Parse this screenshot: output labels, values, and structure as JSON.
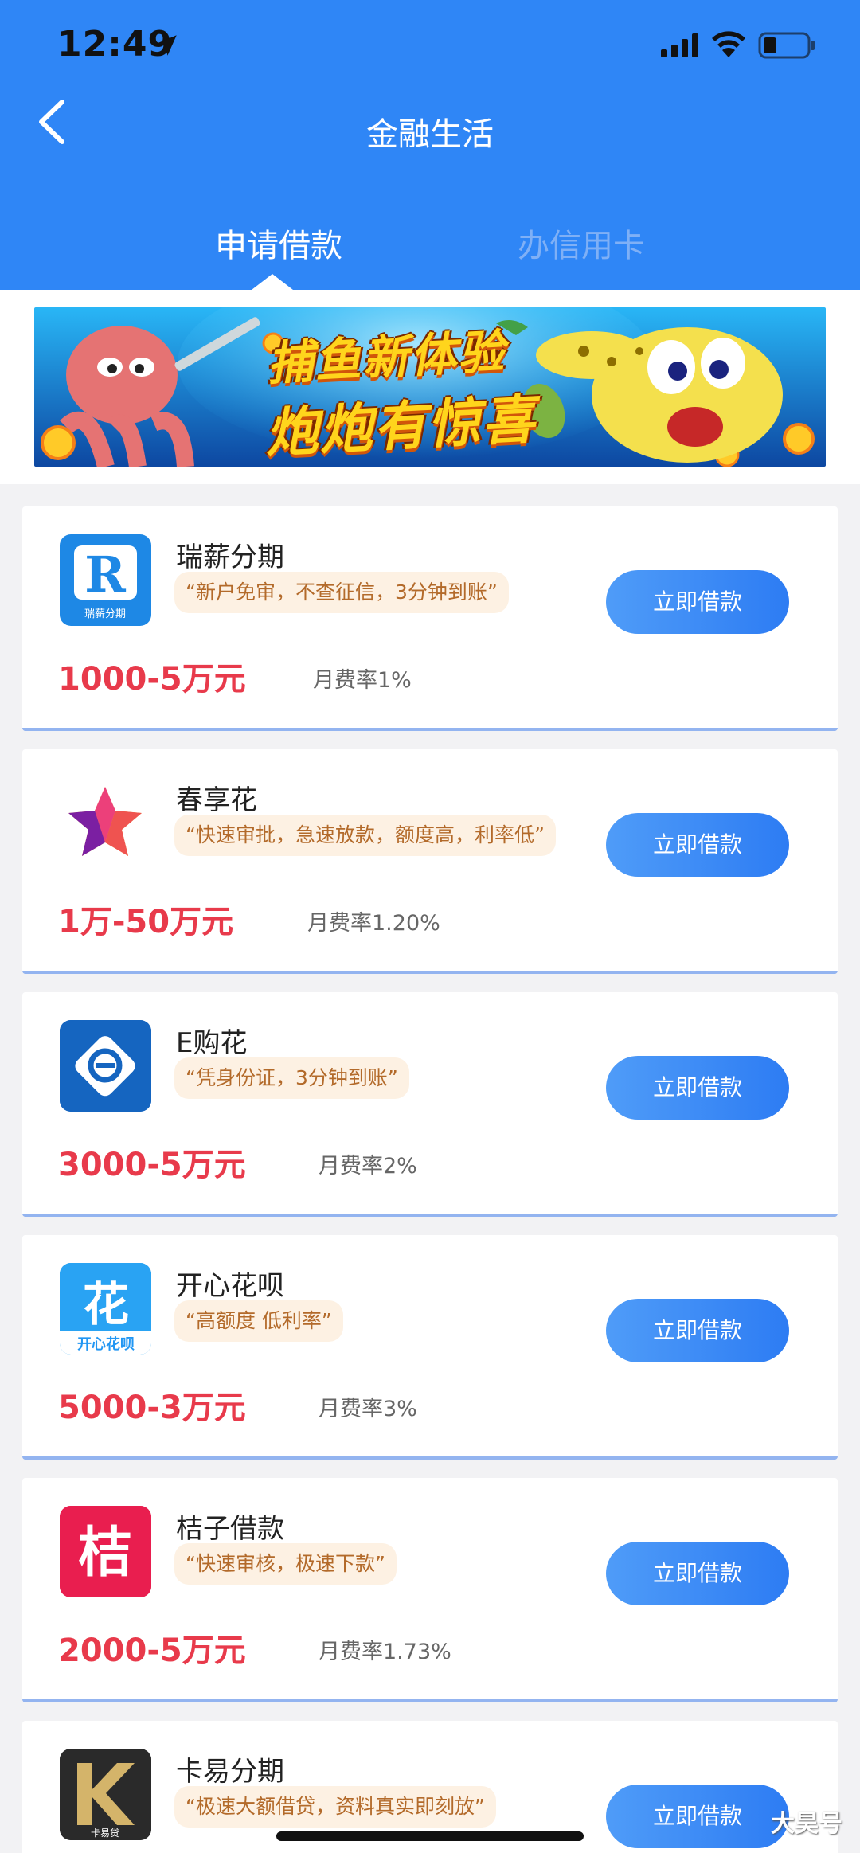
{
  "status": {
    "time": "12:49"
  },
  "header": {
    "title": "金融生活",
    "back_icon": "chevron-left-icon"
  },
  "tabs": [
    {
      "label": "申请借款",
      "active": true
    },
    {
      "label": "办信用卡",
      "active": false
    }
  ],
  "banner": {
    "line1": "捕鱼新体验",
    "line2": "炮炮有惊喜"
  },
  "apply_label": "立即借款",
  "products": [
    {
      "name": "瑞薪分期",
      "tag": "“新户免审，不查征信，3分钟到账”",
      "amount": "1000-5万元",
      "rate": "月费率1%",
      "logo_text": "瑞薪分期",
      "logo_color": "#1e88e5"
    },
    {
      "name": "春享花",
      "tag": "“快速审批，急速放款，额度高，利率低”",
      "amount": "1万-50万元",
      "rate": "月费率1.20%",
      "logo_color": "#f9a825"
    },
    {
      "name": "E购花",
      "tag": "“凭身份证，3分钟到账”",
      "amount": "3000-5万元",
      "rate": "月费率2%",
      "logo_color": "#1565c0"
    },
    {
      "name": "开心花呗",
      "tag": "“高额度 低利率”",
      "amount": "5000-3万元",
      "rate": "月费率3%",
      "logo_text": "开心花呗",
      "logo_color": "#2196f3"
    },
    {
      "name": "桔子借款",
      "tag": "“快速审核，极速下款”",
      "amount": "2000-5万元",
      "rate": "月费率1.73%",
      "logo_text": "桔",
      "logo_color": "#e91e4f"
    },
    {
      "name": "卡易分期",
      "tag": "“极速大额借贷，资料真实即刻放”",
      "amount": "",
      "rate": "",
      "logo_text": "卡易贷",
      "logo_color": "#2a2a2a"
    }
  ],
  "watermark": "大昊号",
  "colors": {
    "header_blue": "#2f86f6",
    "amount_red": "#e83a4b",
    "tag_bg": "#fdf1e3"
  }
}
